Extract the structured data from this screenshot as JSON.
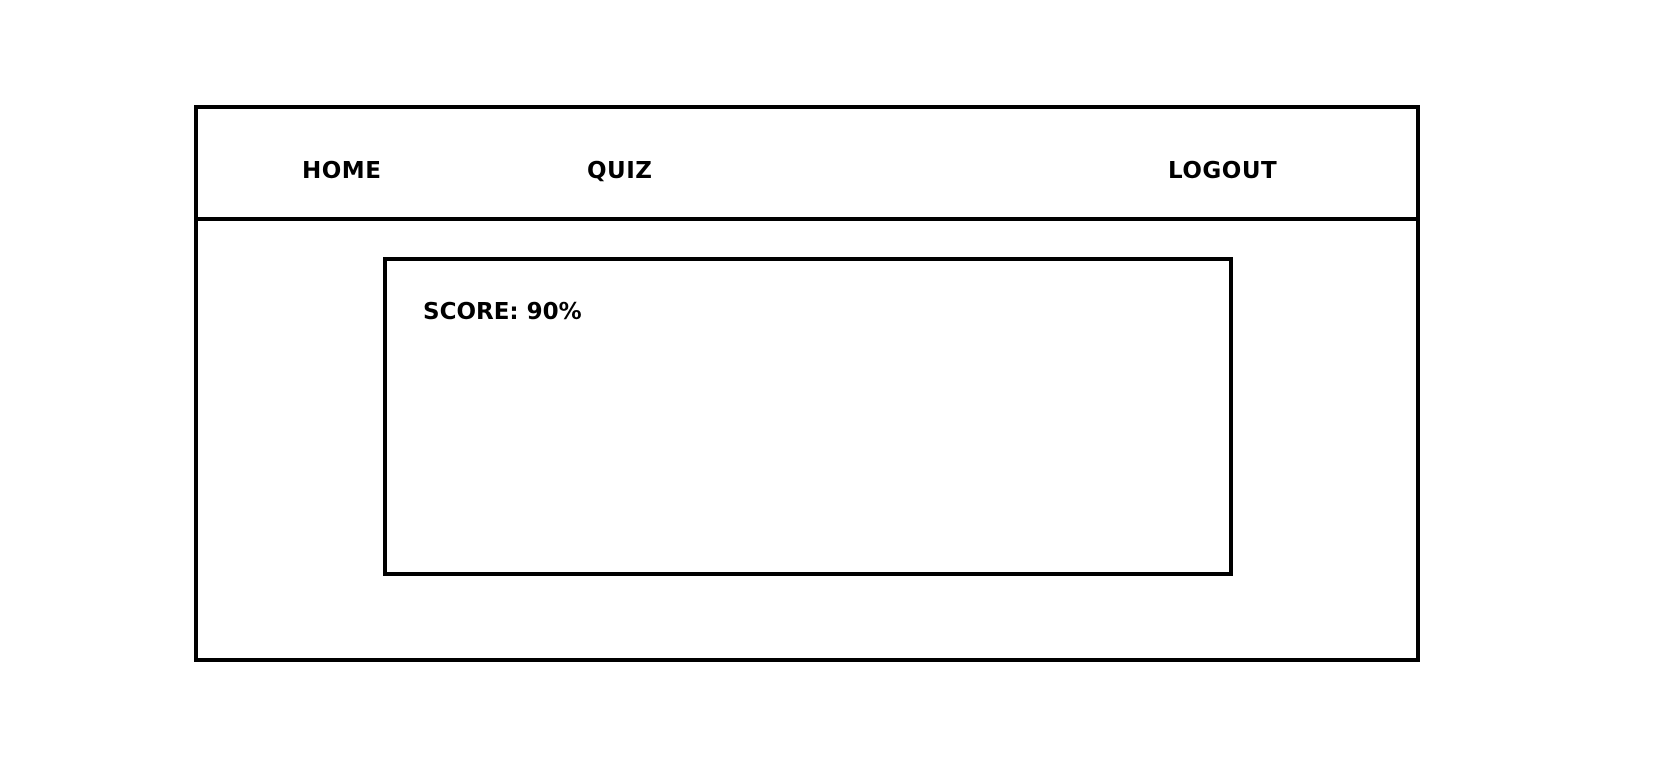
{
  "nav": {
    "home_label": "HOME",
    "quiz_label": "QUIZ",
    "logout_label": "LOGOUT"
  },
  "result": {
    "score_label": "SCORE:",
    "score_value": "90%"
  }
}
